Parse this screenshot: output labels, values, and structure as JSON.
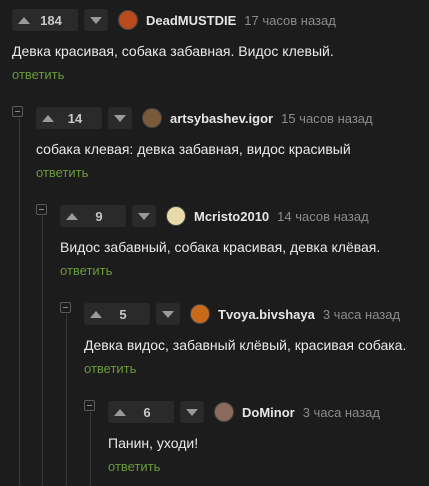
{
  "comments": [
    {
      "votes": "184",
      "username": "DeadMUSTDIE",
      "time": "17 часов назад",
      "text": "Девка красивая, собака забавная. Видос клевый.",
      "reply": "ответить",
      "avatar_color": "#b84a1c"
    },
    {
      "votes": "14",
      "username": "artsybashev.igor",
      "time": "15 часов назад",
      "text": "собака клевая: девка забавная, видос красивый",
      "reply": "ответить",
      "avatar_color": "#7a5a3a"
    },
    {
      "votes": "9",
      "username": "Mcristo2010",
      "time": "14 часов назад",
      "text": "Видос забавный, собака красивая, девка клёвая.",
      "reply": "ответить",
      "avatar_color": "#e8d9a8"
    },
    {
      "votes": "5",
      "username": "Tvoya.bivshaya",
      "time": "3 часа назад",
      "text": "Девка видос, забавный клёвый, красивая собака.",
      "reply": "ответить",
      "avatar_color": "#c86a1a"
    },
    {
      "votes": "6",
      "username": "DoMinor",
      "time": "3 часа назад",
      "text": "Панин, уходи!",
      "reply": "ответить",
      "avatar_color": "#8a6a5a"
    }
  ]
}
